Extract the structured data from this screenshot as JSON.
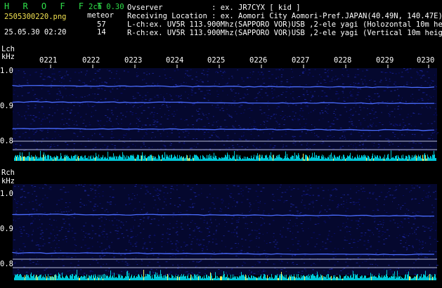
{
  "header": {
    "brand": "H R O F F T",
    "version": "2ch 0.30",
    "filename": "2505300220.png",
    "meteor_label": "meteor",
    "datetime": "25.05.30 02:20",
    "lch_count": "57",
    "rch_count": "14"
  },
  "info": {
    "observer": "Ovserver           : ex. JR7CYX [ kid ]",
    "location": "Receiving Location : ex. Aomori City Aomori-Pref.JAPAN(40.49N, 140.47E)",
    "lch": "L-ch:ex. UV5R 113.900Mhz(SAPPORO VOR)USB ,2-ele yagi (Holozontal 10m height)",
    "rch": "R-ch:ex. UV5R 113.900Mhz(SAPPORO VOR)USB ,2-ele yagi (Vertical 10m height)"
  },
  "time_axis": {
    "labels": [
      "0221",
      "0222",
      "0223",
      "0224",
      "0225",
      "0226",
      "0227",
      "0228",
      "0229",
      "0230"
    ]
  },
  "lch_panel": {
    "channel": "Lch",
    "unit": "kHz",
    "ticks": [
      "1.0",
      "0.9",
      "0.8"
    ]
  },
  "rch_panel": {
    "channel": "Rch",
    "unit": "kHz",
    "ticks": [
      "1.0",
      "0.9",
      "0.8"
    ]
  },
  "colors": {
    "background": "#000000",
    "noise": "#0a0f6a",
    "signal": "#4a6cff",
    "level_bar": "#00c8d8",
    "level_peak": "#f0f060",
    "text_green": "#2fe04a",
    "text_yellow": "#f0e050"
  }
}
